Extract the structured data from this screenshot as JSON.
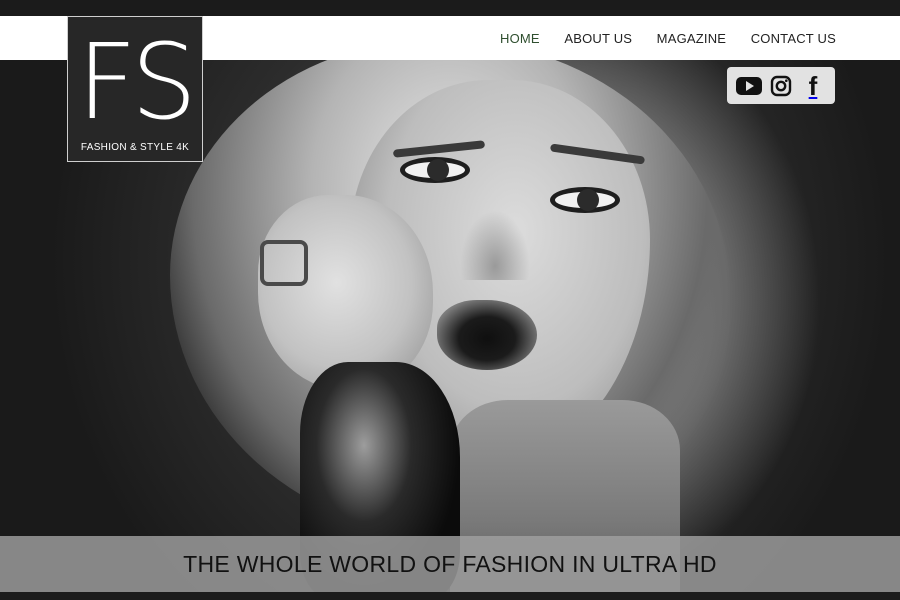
{
  "logo": {
    "mark": "FS",
    "tagline": "FASHION & STYLE 4K"
  },
  "nav": {
    "items": [
      {
        "label": "HOME"
      },
      {
        "label": "ABOUT US"
      },
      {
        "label": "MAGAZINE"
      },
      {
        "label": "CONTACT US"
      }
    ],
    "active": "HOME",
    "active_color": "#2f4f2f"
  },
  "social": {
    "icons": [
      "youtube-icon",
      "instagram-icon",
      "facebook-icon"
    ],
    "facebook_glyph": "f"
  },
  "hero": {
    "headline": "THE WHOLE WORLD OF FASHION IN ULTRA HD"
  },
  "colors": {
    "logo_bg": "#272727",
    "navbar_bg": "#ffffff",
    "banner_bg": "#a0a0a0"
  }
}
